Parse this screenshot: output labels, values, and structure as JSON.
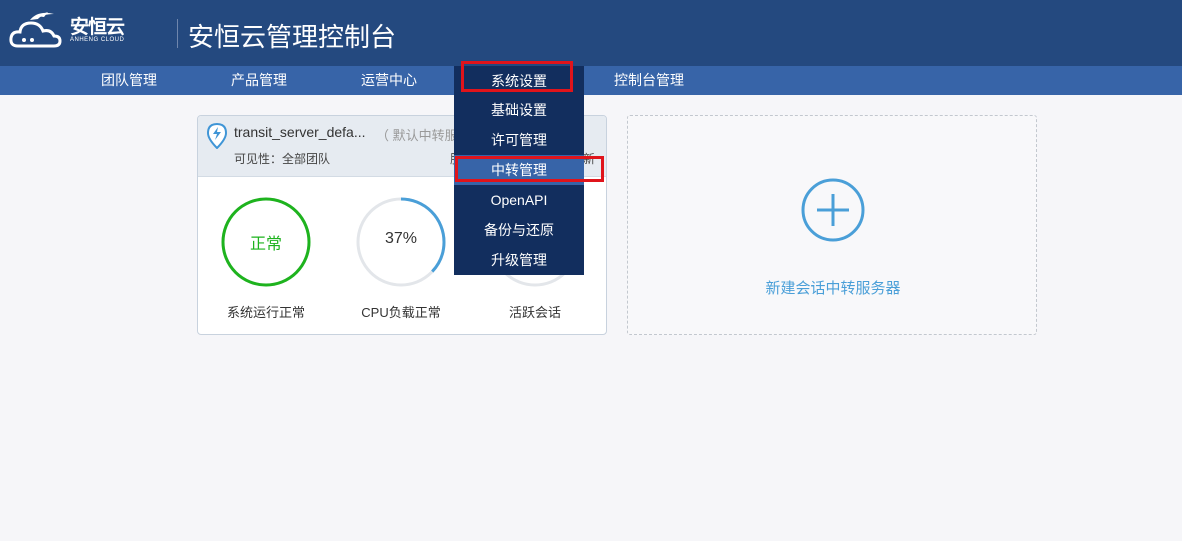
{
  "header": {
    "logo_text": "安恒云",
    "logo_subtext": "ANHENG CLOUD",
    "title": "安恒云管理控制台"
  },
  "nav": {
    "items": [
      {
        "label": "团队管理"
      },
      {
        "label": "产品管理"
      },
      {
        "label": "运营中心"
      },
      {
        "label": "系统设置"
      },
      {
        "label": "控制台管理"
      }
    ]
  },
  "dropdown": {
    "items": [
      {
        "label": "基础设置"
      },
      {
        "label": "许可管理"
      },
      {
        "label": "中转管理"
      },
      {
        "label": "OpenAPI"
      },
      {
        "label": "备份与还原"
      },
      {
        "label": "升级管理"
      }
    ],
    "active_index": 2
  },
  "server_card": {
    "name": "transit_server_defa...",
    "default_tag": "（ 默认中转服",
    "visibility": "可见性：全部团队",
    "fragment_left": "服",
    "fragment_right": "新",
    "gauges": [
      {
        "value_text": "正常",
        "label": "系统运行正常",
        "percent": 100,
        "color": "#1eb31e"
      },
      {
        "value_text": "37%",
        "label": "CPU负载正常",
        "percent": 37,
        "color": "#4a9fd8"
      },
      {
        "value_text": "",
        "label": "活跃会话",
        "percent": 0,
        "color": "#4a9fd8"
      }
    ]
  },
  "add_card": {
    "label": "新建会话中转服务器"
  },
  "colors": {
    "header_bg": "#24497f",
    "nav_bg": "#3764a8",
    "dropdown_bg": "#122e5e",
    "highlight": "#e0141b",
    "accent": "#4a9fd8",
    "ok": "#1eb31e"
  }
}
